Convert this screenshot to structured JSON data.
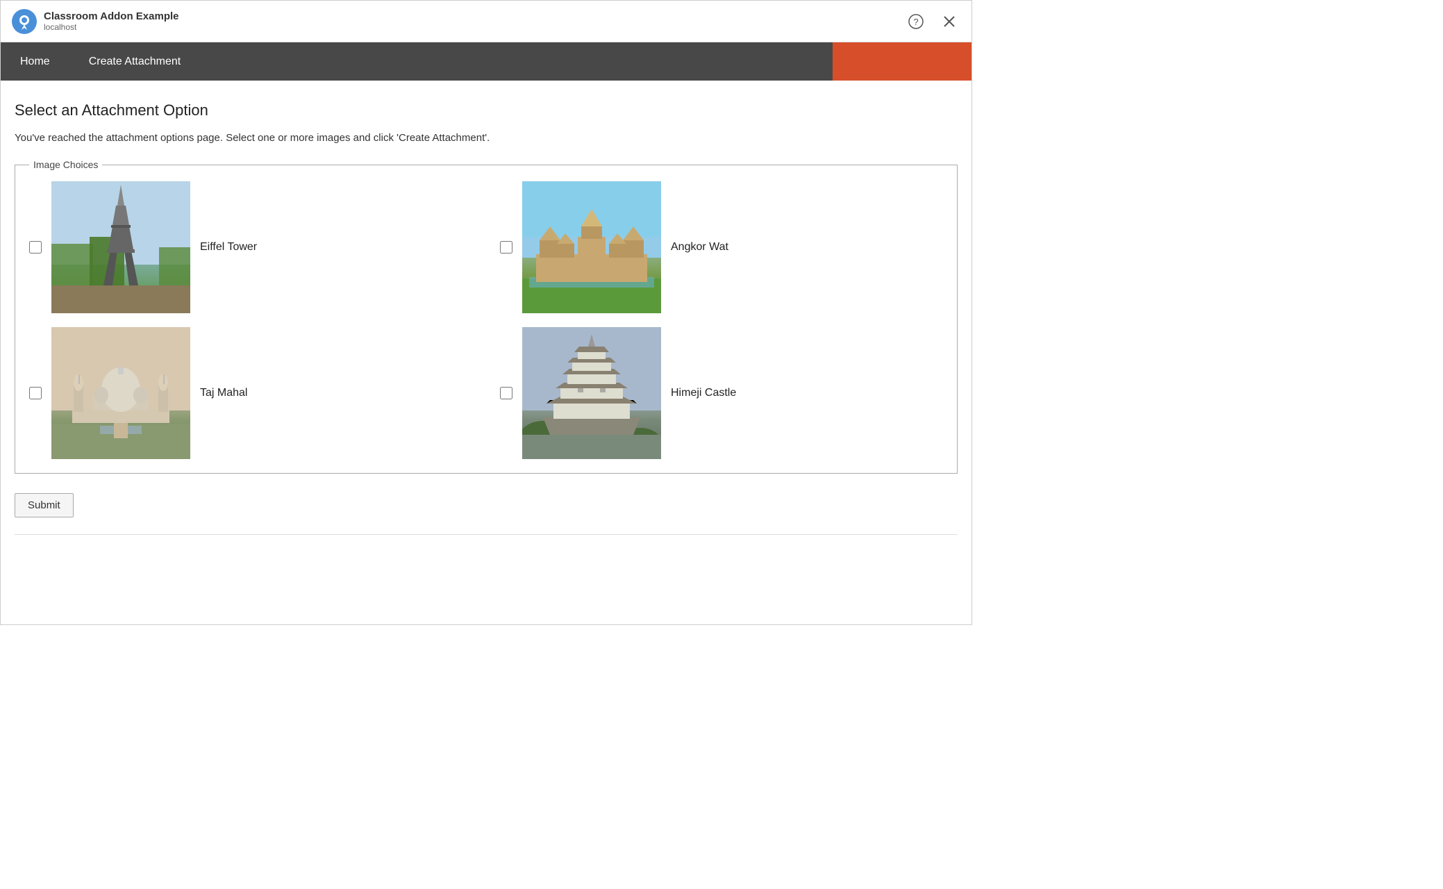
{
  "titleBar": {
    "appTitle": "Classroom Addon Example",
    "appSubtitle": "localhost",
    "helpButtonLabel": "?",
    "closeButtonLabel": "×"
  },
  "navBar": {
    "items": [
      {
        "label": "Home",
        "id": "home"
      },
      {
        "label": "Create Attachment",
        "id": "create-attachment"
      }
    ],
    "accentColor": "#d64e2a"
  },
  "mainContent": {
    "pageHeading": "Select an Attachment Option",
    "pageDescription": "You've reached the attachment options page. Select one or more images and click 'Create Attachment'.",
    "fieldsetLegend": "Image Choices",
    "images": [
      {
        "id": "eiffel",
        "label": "Eiffel Tower",
        "checked": false
      },
      {
        "id": "angkor",
        "label": "Angkor Wat",
        "checked": false
      },
      {
        "id": "taj",
        "label": "Taj Mahal",
        "checked": false
      },
      {
        "id": "himeji",
        "label": "Himeji Castle",
        "checked": false
      }
    ],
    "submitLabel": "Submit"
  }
}
